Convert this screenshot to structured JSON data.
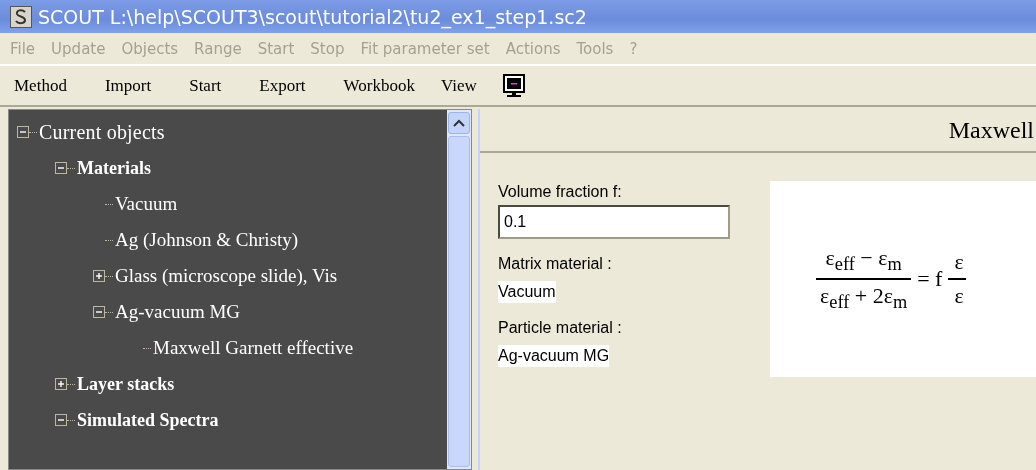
{
  "window": {
    "title": "SCOUT L:\\help\\SCOUT3\\scout\\tutorial2\\tu2_ex1_step1.sc2"
  },
  "menu": [
    {
      "label": "File",
      "disabled": true
    },
    {
      "label": "Update",
      "disabled": true
    },
    {
      "label": "Objects",
      "disabled": true
    },
    {
      "label": "Range",
      "disabled": true
    },
    {
      "label": "Start",
      "disabled": true
    },
    {
      "label": "Stop",
      "disabled": true
    },
    {
      "label": "Fit parameter set",
      "disabled": true
    },
    {
      "label": "Actions",
      "disabled": true
    },
    {
      "label": "Tools",
      "disabled": true
    },
    {
      "label": "?",
      "disabled": true
    }
  ],
  "toolbar": [
    "Method",
    "Import",
    "Start",
    "Export",
    "Workbook",
    "View"
  ],
  "tree": [
    {
      "label": "Current objects",
      "kind": "root",
      "expanded": true,
      "children": [
        {
          "label": "Materials",
          "kind": "category",
          "expanded": true,
          "children": [
            {
              "label": "Vacuum",
              "kind": "object"
            },
            {
              "label": "Ag (Johnson & Christy)",
              "kind": "object"
            },
            {
              "label": "Glass (microscope slide), Vis",
              "kind": "object",
              "expanded": false
            },
            {
              "label": "Ag-vacuum MG",
              "kind": "object",
              "expanded": true,
              "children": [
                {
                  "label": "Maxwell Garnett effective",
                  "kind": "object"
                }
              ]
            }
          ]
        },
        {
          "label": "Layer stacks",
          "kind": "category",
          "expanded": false
        },
        {
          "label": "Simulated Spectra",
          "kind": "category",
          "expanded": true
        }
      ]
    }
  ],
  "panel": {
    "title": "Maxwell",
    "volume_fraction": {
      "label": "Volume fraction f:",
      "value": "0.1"
    },
    "matrix": {
      "label": "Matrix material :",
      "value": "Vacuum"
    },
    "particle": {
      "label": "Particle material :",
      "value": "Ag-vacuum MG"
    },
    "formula": {
      "numerator": "ε$_{eff}$ − ε$_{m}$",
      "denominator": "ε$_{eff}$ + 2ε$_{m}$",
      "equals": "= f",
      "cut_numerator": "ε",
      "cut_denominator": "ε"
    }
  }
}
